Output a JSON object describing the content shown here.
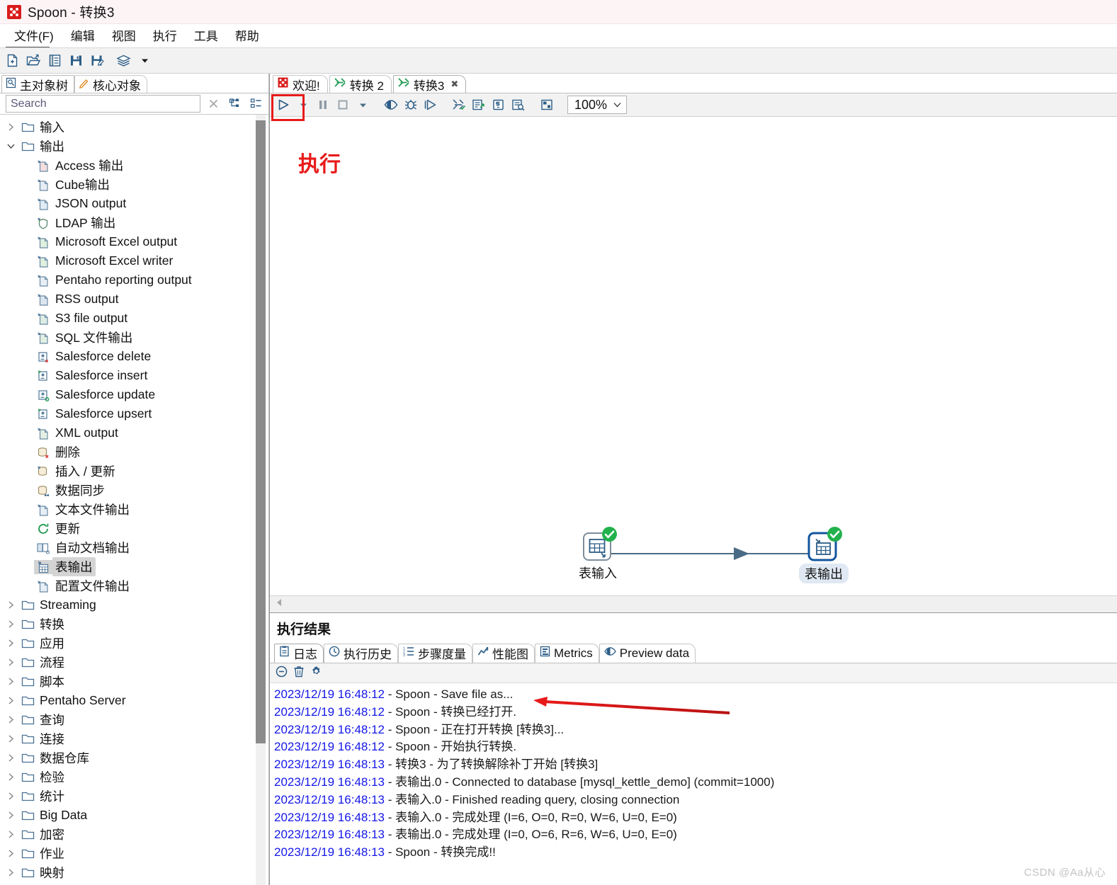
{
  "window": {
    "title": "Spoon - 转换3",
    "app_icon": "spoon-icon"
  },
  "menu": {
    "items": [
      {
        "label": "文件(F)",
        "name": "menu-file"
      },
      {
        "label": "编辑",
        "name": "menu-edit"
      },
      {
        "label": "视图",
        "name": "menu-view"
      },
      {
        "label": "执行",
        "name": "menu-run"
      },
      {
        "label": "工具",
        "name": "menu-tools"
      },
      {
        "label": "帮助",
        "name": "menu-help"
      }
    ]
  },
  "main_toolbar": {
    "buttons": [
      {
        "name": "new-file-icon",
        "title": "新建"
      },
      {
        "name": "open-file-icon",
        "title": "打开"
      },
      {
        "name": "explorer-icon",
        "title": "资源库浏览"
      },
      {
        "name": "save-icon",
        "title": "保存"
      },
      {
        "name": "save-as-icon",
        "title": "另存为"
      },
      {
        "name": "layers-icon",
        "title": "图层"
      },
      {
        "name": "chevron-down-icon",
        "title": "更多"
      }
    ]
  },
  "left_panel": {
    "tabs": [
      {
        "label": "主对象树",
        "name": "tab-main-object-tree",
        "icon": "document-icon",
        "active": true
      },
      {
        "label": "核心对象",
        "name": "tab-core-objects",
        "icon": "pencil-icon",
        "active": false
      }
    ],
    "search": {
      "placeholder": "Search",
      "value": "",
      "clear_icon": "close-icon",
      "expand_icon": "expand-tree-icon",
      "collapse_icon": "collapse-tree-icon"
    },
    "tree": [
      {
        "label": "输入",
        "type": "folder",
        "expanded": false,
        "depth": 0
      },
      {
        "label": "输出",
        "type": "folder",
        "expanded": true,
        "depth": 0
      },
      {
        "label": "Access 输出",
        "type": "step",
        "icon": "access-output-icon",
        "depth": 1
      },
      {
        "label": "Cube输出",
        "type": "step",
        "icon": "cube-output-icon",
        "depth": 1
      },
      {
        "label": "JSON output",
        "type": "step",
        "icon": "json-output-icon",
        "depth": 1
      },
      {
        "label": "LDAP 输出",
        "type": "step",
        "icon": "ldap-output-icon",
        "depth": 1
      },
      {
        "label": "Microsoft Excel output",
        "type": "step",
        "icon": "excel-output-icon",
        "depth": 1
      },
      {
        "label": "Microsoft Excel writer",
        "type": "step",
        "icon": "excel-writer-icon",
        "depth": 1
      },
      {
        "label": "Pentaho reporting output",
        "type": "step",
        "icon": "report-output-icon",
        "depth": 1
      },
      {
        "label": "RSS output",
        "type": "step",
        "icon": "rss-output-icon",
        "depth": 1
      },
      {
        "label": "S3 file output",
        "type": "step",
        "icon": "s3-output-icon",
        "depth": 1
      },
      {
        "label": "SQL 文件输出",
        "type": "step",
        "icon": "sql-file-output-icon",
        "depth": 1
      },
      {
        "label": "Salesforce delete",
        "type": "step",
        "icon": "salesforce-delete-icon",
        "depth": 1
      },
      {
        "label": "Salesforce insert",
        "type": "step",
        "icon": "salesforce-insert-icon",
        "depth": 1
      },
      {
        "label": "Salesforce update",
        "type": "step",
        "icon": "salesforce-update-icon",
        "depth": 1
      },
      {
        "label": "Salesforce upsert",
        "type": "step",
        "icon": "salesforce-upsert-icon",
        "depth": 1
      },
      {
        "label": "XML output",
        "type": "step",
        "icon": "xml-output-icon",
        "depth": 1
      },
      {
        "label": "删除",
        "type": "step",
        "icon": "delete-icon",
        "depth": 1
      },
      {
        "label": "插入 / 更新",
        "type": "step",
        "icon": "insert-update-icon",
        "depth": 1
      },
      {
        "label": "数据同步",
        "type": "step",
        "icon": "sync-icon",
        "depth": 1
      },
      {
        "label": "文本文件输出",
        "type": "step",
        "icon": "text-file-output-icon",
        "depth": 1
      },
      {
        "label": "更新",
        "type": "step",
        "icon": "update-icon",
        "depth": 1
      },
      {
        "label": "自动文档输出",
        "type": "step",
        "icon": "auto-doc-output-icon",
        "depth": 1
      },
      {
        "label": "表输出",
        "type": "step",
        "icon": "table-output-icon",
        "depth": 1,
        "selected": true
      },
      {
        "label": "配置文件输出",
        "type": "step",
        "icon": "properties-output-icon",
        "depth": 1
      },
      {
        "label": "Streaming",
        "type": "folder",
        "expanded": false,
        "depth": 0
      },
      {
        "label": "转换",
        "type": "folder",
        "expanded": false,
        "depth": 0
      },
      {
        "label": "应用",
        "type": "folder",
        "expanded": false,
        "depth": 0
      },
      {
        "label": "流程",
        "type": "folder",
        "expanded": false,
        "depth": 0
      },
      {
        "label": "脚本",
        "type": "folder",
        "expanded": false,
        "depth": 0
      },
      {
        "label": "Pentaho Server",
        "type": "folder",
        "expanded": false,
        "depth": 0
      },
      {
        "label": "查询",
        "type": "folder",
        "expanded": false,
        "depth": 0
      },
      {
        "label": "连接",
        "type": "folder",
        "expanded": false,
        "depth": 0
      },
      {
        "label": "数据仓库",
        "type": "folder",
        "expanded": false,
        "depth": 0
      },
      {
        "label": "检验",
        "type": "folder",
        "expanded": false,
        "depth": 0
      },
      {
        "label": "统计",
        "type": "folder",
        "expanded": false,
        "depth": 0
      },
      {
        "label": "Big Data",
        "type": "folder",
        "expanded": false,
        "depth": 0
      },
      {
        "label": "加密",
        "type": "folder",
        "expanded": false,
        "depth": 0
      },
      {
        "label": "作业",
        "type": "folder",
        "expanded": false,
        "depth": 0
      },
      {
        "label": "映射",
        "type": "folder",
        "expanded": false,
        "depth": 0
      }
    ]
  },
  "editor": {
    "tabs": [
      {
        "label": "欢迎!",
        "name": "tab-welcome",
        "icon": "spoon-icon",
        "active": false,
        "closable": false
      },
      {
        "label": "转换 2",
        "name": "tab-trans-2",
        "icon": "transformation-icon",
        "active": false,
        "closable": false
      },
      {
        "label": "转换3",
        "name": "tab-trans-3",
        "icon": "transformation-icon",
        "active": true,
        "closable": true
      }
    ],
    "toolbar": [
      {
        "name": "run-button",
        "title": "执行",
        "icon": "play-icon",
        "highlighted": true
      },
      {
        "name": "run-options-button",
        "title": "执行选项",
        "icon": "chevron-down-icon"
      },
      {
        "name": "pause-button",
        "title": "暂停",
        "icon": "pause-icon"
      },
      {
        "name": "stop-button",
        "title": "停止",
        "icon": "stop-icon"
      },
      {
        "name": "stop-options-button",
        "title": "停止选项",
        "icon": "chevron-down-icon"
      },
      {
        "name": "preview-button",
        "title": "预览",
        "icon": "eye-icon"
      },
      {
        "name": "debug-button",
        "title": "调试",
        "icon": "bug-icon"
      },
      {
        "name": "replay-button",
        "title": "重放",
        "icon": "play-outline-icon"
      },
      {
        "name": "verify-button",
        "title": "检验转换",
        "icon": "verify-icon"
      },
      {
        "name": "impact-button",
        "title": "影响分析",
        "icon": "impact-icon"
      },
      {
        "name": "sql-button",
        "title": "生成SQL",
        "icon": "sql-icon"
      },
      {
        "name": "inspect-button",
        "title": "数据库浏览",
        "icon": "inspect-icon"
      },
      {
        "name": "arrange-button",
        "title": "排列",
        "icon": "arrange-icon"
      }
    ],
    "zoom": {
      "value": "100%",
      "chevron": "chevron-down-icon"
    },
    "annotation": "执行",
    "canvas": {
      "steps": [
        {
          "label": "表输入",
          "name": "step-table-input",
          "icon": "table-input-icon",
          "status": "ok",
          "selected": false
        },
        {
          "label": "表输出",
          "name": "step-table-output",
          "icon": "table-output-icon",
          "status": "ok",
          "selected": true
        }
      ],
      "hops": [
        {
          "from": "表输入",
          "to": "表输出"
        }
      ]
    }
  },
  "results": {
    "title": "执行结果",
    "tabs": [
      {
        "label": "日志",
        "name": "tab-log",
        "icon": "log-icon",
        "active": true
      },
      {
        "label": "执行历史",
        "name": "tab-exec-history",
        "icon": "clock-icon",
        "active": false
      },
      {
        "label": "步骤度量",
        "name": "tab-step-metrics",
        "icon": "list-icon",
        "active": false
      },
      {
        "label": "性能图",
        "name": "tab-perf-graph",
        "icon": "chart-icon",
        "active": false
      },
      {
        "label": "Metrics",
        "name": "tab-metrics",
        "icon": "metrics-icon",
        "active": false
      },
      {
        "label": "Preview data",
        "name": "tab-preview-data",
        "icon": "preview-icon",
        "active": false
      }
    ],
    "log_toolbar": [
      {
        "name": "collapse-log-button",
        "icon": "minus-circle-icon"
      },
      {
        "name": "clear-log-button",
        "icon": "trash-icon"
      },
      {
        "name": "log-settings-button",
        "icon": "gear-icon"
      }
    ],
    "log_lines": [
      {
        "ts": "2023/12/19 16:48:12",
        "msg": " - Spoon - Save file as..."
      },
      {
        "ts": "2023/12/19 16:48:12",
        "msg": " - Spoon - 转换已经打开."
      },
      {
        "ts": "2023/12/19 16:48:12",
        "msg": " - Spoon - 正在打开转换 [转换3]..."
      },
      {
        "ts": "2023/12/19 16:48:12",
        "msg": " - Spoon - 开始执行转换."
      },
      {
        "ts": "2023/12/19 16:48:13",
        "msg": " - 转换3 - 为了转换解除补丁开始  [转换3]"
      },
      {
        "ts": "2023/12/19 16:48:13",
        "msg": " - 表输出.0 - Connected to database [mysql_kettle_demo] (commit=1000)"
      },
      {
        "ts": "2023/12/19 16:48:13",
        "msg": " - 表输入.0 - Finished reading query, closing connection"
      },
      {
        "ts": "2023/12/19 16:48:13",
        "msg": " - 表输入.0 - 完成处理 (I=6, O=0, R=0, W=6, U=0, E=0)"
      },
      {
        "ts": "2023/12/19 16:48:13",
        "msg": " - 表输出.0 - 完成处理 (I=0, O=6, R=6, W=6, U=0, E=0)"
      },
      {
        "ts": "2023/12/19 16:48:13",
        "msg": " - Spoon - 转换完成!!"
      }
    ]
  },
  "watermark": "CSDN @Aa从心",
  "colors": {
    "accent_red": "#e81a1a",
    "log_timestamp": "#1417e8",
    "icon_blue": "#2c5d87",
    "status_green": "#22b14c",
    "selection_gray": "#d4d4d4"
  }
}
